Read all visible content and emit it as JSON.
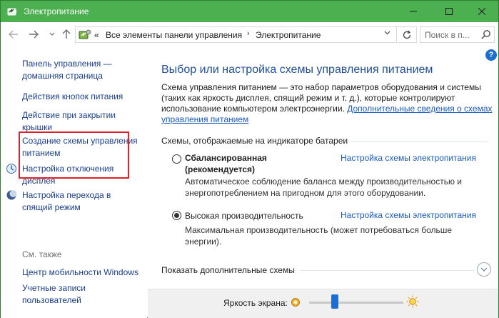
{
  "window": {
    "title": "Электропитание",
    "accent": "#4caf50"
  },
  "address_bar": {
    "overflow": "«",
    "crumbs": [
      "Все элементы панели управления",
      "Электропитание"
    ],
    "search_placeholder": "Поиск в п..."
  },
  "left_pane": {
    "links": [
      {
        "label": "Панель управления —\nдомашняя страница"
      },
      {
        "label": "Действия кнопок питания"
      },
      {
        "label": "Действие при закрытии\nкрышки"
      },
      {
        "label": "Создание схемы управления\nпитанием"
      },
      {
        "label": "Настройка отключения\nдисплея",
        "icon": "display-off-icon"
      },
      {
        "label": "Настройка перехода в\nспящий режим",
        "icon": "moon-icon"
      }
    ],
    "see_also": "См. также",
    "see_also_links": [
      {
        "label": "Центр мобильности Windows"
      },
      {
        "label": "Учетные записи\nпользователей"
      }
    ],
    "highlight_color": "#e0202a"
  },
  "main": {
    "title": "Выбор или настройка схемы управления питанием",
    "intro_text": "Схема управления питанием — это набор параметров оборудования и системы (таких как яркость дисплея, спящий режим и т. д.), которые контролируют использование компьютером электроэнергии. ",
    "intro_link": "Дополнительные сведения о схемах управления питанием",
    "group_header": "Схемы, отображаемые на индикаторе батареи",
    "plans": [
      {
        "name": "Сбалансированная\n(рекомендуется)",
        "selected": false,
        "link": "Настройка схемы электропитания",
        "description": "Автоматическое соблюдение баланса между производительностью и\nэнергопотреблением на пригодном для этого оборудовании."
      },
      {
        "name": "Высокая производительность",
        "selected": true,
        "link": "Настройка схемы электропитания",
        "description": "Максимальная производительность (может потребоваться больше\nэнергии)."
      }
    ],
    "more_plans": "Показать дополнительные схемы"
  },
  "brightness": {
    "label": "Яркость экрана:",
    "level": 0.25
  }
}
